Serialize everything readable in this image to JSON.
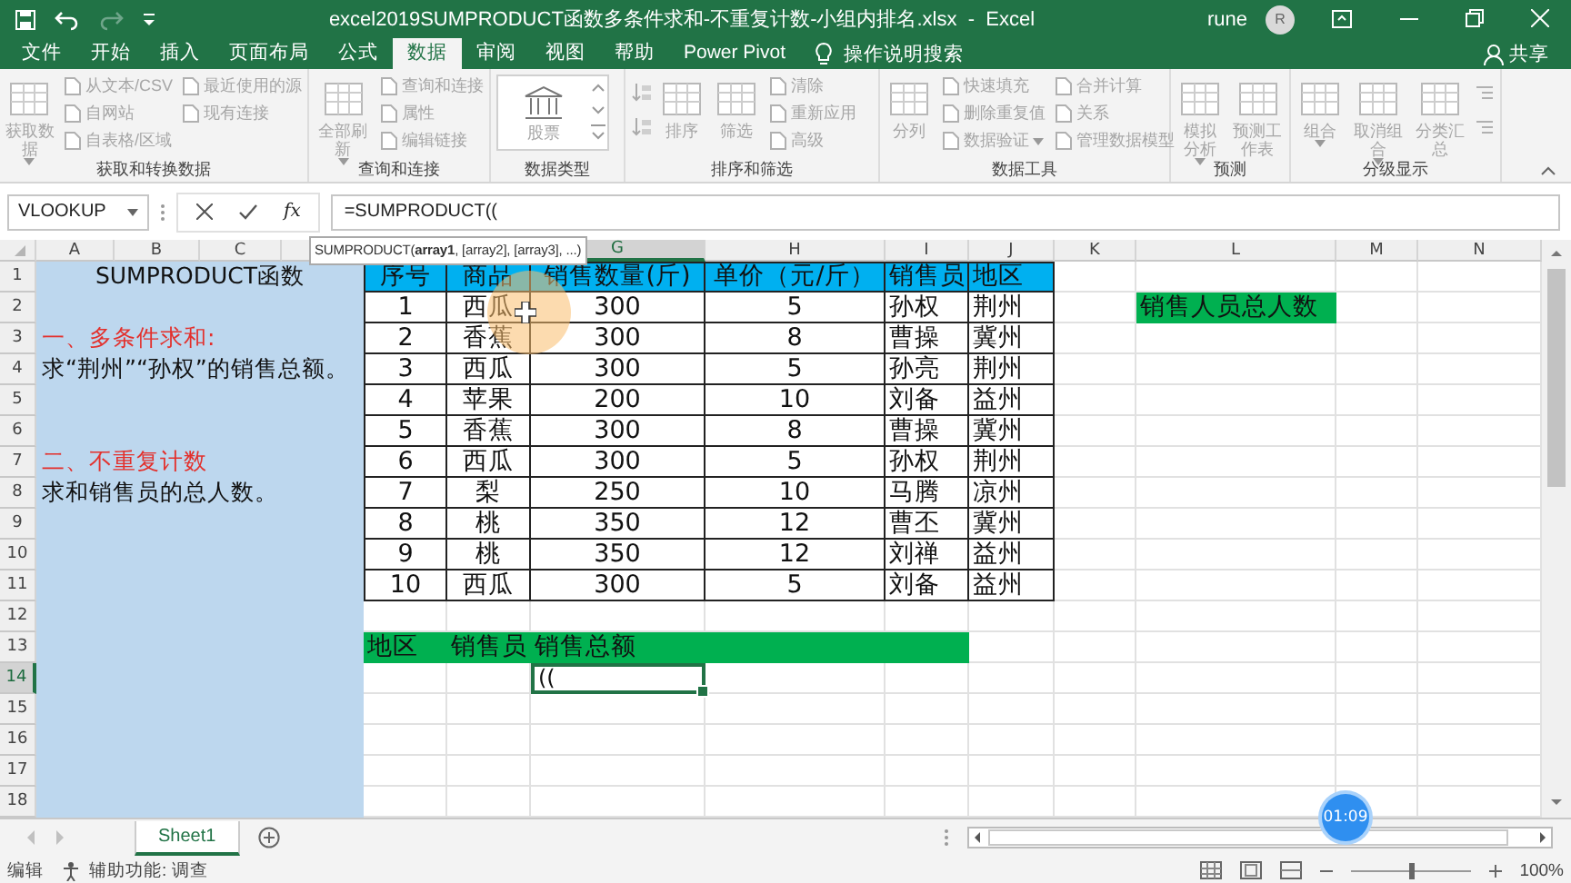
{
  "title_bar": {
    "title": "excel2019SUMPRODUCT函数多条件求和-不重复计数-小组内排名.xlsx  -  Excel",
    "user": "rune",
    "avatar": "R"
  },
  "ribbon_tabs": [
    {
      "label": "文件",
      "selected": false
    },
    {
      "label": "开始",
      "selected": false
    },
    {
      "label": "插入",
      "selected": false
    },
    {
      "label": "页面布局",
      "selected": false
    },
    {
      "label": "公式",
      "selected": false
    },
    {
      "label": "数据",
      "selected": true
    },
    {
      "label": "审阅",
      "selected": false
    },
    {
      "label": "视图",
      "selected": false
    },
    {
      "label": "帮助",
      "selected": false
    },
    {
      "label": "Power Pivot",
      "selected": false
    }
  ],
  "tell_me": "操作说明搜索",
  "share": "共享",
  "ribbon_groups": [
    {
      "label": "获取和转换数据",
      "items": [
        {
          "kind": "large",
          "label": "获取数据",
          "dropdown": true,
          "disabled": true
        },
        {
          "kind": "small",
          "label": "从文本/CSV",
          "disabled": true
        },
        {
          "kind": "small",
          "label": "自网站",
          "disabled": true
        },
        {
          "kind": "small",
          "label": "自表格/区域",
          "disabled": true
        },
        {
          "kind": "small",
          "label": "最近使用的源",
          "disabled": true
        },
        {
          "kind": "small",
          "label": "现有连接",
          "disabled": true
        }
      ]
    },
    {
      "label": "查询和连接",
      "items": [
        {
          "kind": "large",
          "label": "全部刷新",
          "dropdown": true,
          "disabled": true
        },
        {
          "kind": "small",
          "label": "查询和连接",
          "disabled": true
        },
        {
          "kind": "small",
          "label": "属性",
          "disabled": true
        },
        {
          "kind": "small",
          "label": "编辑链接",
          "disabled": true
        }
      ]
    },
    {
      "label": "数据类型",
      "items": [
        {
          "kind": "gallery",
          "label": "股票",
          "disabled": true
        }
      ]
    },
    {
      "label": "排序和筛选",
      "items": [
        {
          "kind": "sort",
          "disabled": true
        },
        {
          "kind": "sort",
          "disabled": true
        },
        {
          "kind": "large",
          "label": "排序",
          "disabled": true
        },
        {
          "kind": "large",
          "label": "筛选",
          "disabled": true
        },
        {
          "kind": "small",
          "label": "清除",
          "disabled": true
        },
        {
          "kind": "small",
          "label": "重新应用",
          "disabled": true
        },
        {
          "kind": "small",
          "label": "高级",
          "disabled": true
        }
      ]
    },
    {
      "label": "数据工具",
      "items": [
        {
          "kind": "large",
          "label": "分列",
          "disabled": true
        },
        {
          "kind": "small",
          "label": "快速填充",
          "disabled": true
        },
        {
          "kind": "small",
          "label": "删除重复值",
          "disabled": true
        },
        {
          "kind": "small",
          "label": "数据验证",
          "dropdown": true,
          "disabled": true
        },
        {
          "kind": "small",
          "label": "合并计算",
          "disabled": true
        },
        {
          "kind": "small",
          "label": "关系",
          "disabled": true
        },
        {
          "kind": "small",
          "label": "管理数据模型",
          "disabled": true
        }
      ]
    },
    {
      "label": "预测",
      "items": [
        {
          "kind": "large",
          "label": "模拟分析",
          "dropdown": true,
          "disabled": true
        },
        {
          "kind": "large",
          "label": "预测工作表",
          "disabled": true
        }
      ]
    },
    {
      "label": "分级显示",
      "items": [
        {
          "kind": "large",
          "label": "组合",
          "dropdown": true,
          "disabled": true
        },
        {
          "kind": "large",
          "label": "取消组合",
          "dropdown": true,
          "disabled": true
        },
        {
          "kind": "large",
          "label": "分类汇总",
          "disabled": true
        },
        {
          "kind": "outline",
          "disabled": true
        },
        {
          "kind": "outline",
          "disabled": true
        }
      ]
    }
  ],
  "formula_bar": {
    "name_box": "VLOOKUP",
    "function_button": "fx",
    "formula": "=SUMPRODUCT(("
  },
  "sheet": {
    "tooltip": "SUMPRODUCT(**array1**, [array2], [array3], ...)",
    "column_headers": [
      {
        "label": "A",
        "selected": false
      },
      {
        "label": "B",
        "selected": false
      },
      {
        "label": "C",
        "selected": false
      },
      {
        "covered": true
      },
      {
        "covered": true
      },
      {
        "covered": true
      },
      {
        "label": "G",
        "selected": true
      },
      {
        "label": "H",
        "selected": false
      },
      {
        "label": "I",
        "selected": false
      },
      {
        "label": "J",
        "selected": false
      },
      {
        "label": "K",
        "selected": false
      },
      {
        "label": "L",
        "selected": false
      },
      {
        "label": "M",
        "selected": false
      },
      {
        "label": "N",
        "selected": false
      }
    ],
    "row_headers": [
      {
        "label": "1",
        "selected": false
      },
      {
        "label": "2",
        "selected": false
      },
      {
        "label": "3",
        "selected": false
      },
      {
        "label": "4",
        "selected": false
      },
      {
        "label": "5",
        "selected": false
      },
      {
        "label": "6",
        "selected": false
      },
      {
        "label": "7",
        "selected": false
      },
      {
        "label": "8",
        "selected": false
      },
      {
        "label": "9",
        "selected": false
      },
      {
        "label": "10",
        "selected": false
      },
      {
        "label": "11",
        "selected": false
      },
      {
        "label": "12",
        "selected": false
      },
      {
        "label": "13",
        "selected": false
      },
      {
        "label": "14",
        "selected": true
      },
      {
        "label": "15",
        "selected": false
      },
      {
        "label": "16",
        "selected": false
      },
      {
        "label": "17",
        "selected": false
      },
      {
        "label": "18",
        "selected": false
      }
    ],
    "left_panel": [
      {
        "kind": "title",
        "text": "SUMPRODUCT函数"
      },
      {
        "kind": "blank"
      },
      {
        "kind": "heading",
        "text": "一、多条件求和:"
      },
      {
        "kind": "body",
        "text": "求“荆州”“孙权”的销售总额。"
      },
      {
        "kind": "blank"
      },
      {
        "kind": "blank"
      },
      {
        "kind": "heading",
        "text": "二、不重复计数"
      },
      {
        "kind": "body",
        "text": "求和销售员的总人数。"
      }
    ],
    "table": {
      "columns": [
        "序号",
        "商品",
        "销售数量(斤)",
        "单价（元/斤）",
        "销售员",
        "地区"
      ],
      "rows": [
        [
          "1",
          "西瓜",
          "300",
          "5",
          "孙权",
          "荆州"
        ],
        [
          "2",
          "香蕉",
          "300",
          "8",
          "曹操",
          "冀州"
        ],
        [
          "3",
          "西瓜",
          "300",
          "5",
          "孙亮",
          "荆州"
        ],
        [
          "4",
          "苹果",
          "200",
          "10",
          "刘备",
          "益州"
        ],
        [
          "5",
          "香蕉",
          "300",
          "8",
          "曹操",
          "冀州"
        ],
        [
          "6",
          "西瓜",
          "300",
          "5",
          "孙权",
          "荆州"
        ],
        [
          "7",
          "梨",
          "250",
          "10",
          "马腾",
          "凉州"
        ],
        [
          "8",
          "桃",
          "350",
          "12",
          "曹丕",
          "冀州"
        ],
        [
          "9",
          "桃",
          "350",
          "12",
          "刘禅",
          "益州"
        ],
        [
          "10",
          "西瓜",
          "300",
          "5",
          "刘备",
          "益州"
        ]
      ]
    },
    "summary_label": "销售人员总人数",
    "summary_header": [
      "地区",
      "销售员",
      "销售总额"
    ],
    "active_cell": "(("
  },
  "timer": "01:09",
  "sheet_tabs": [
    {
      "label": "Sheet1",
      "selected": true
    }
  ],
  "status_bar": {
    "mode": "编辑",
    "accessibility": "辅助功能: 调查",
    "zoom": "100%",
    "zoom_slider": {
      "level": 0.5
    }
  }
}
